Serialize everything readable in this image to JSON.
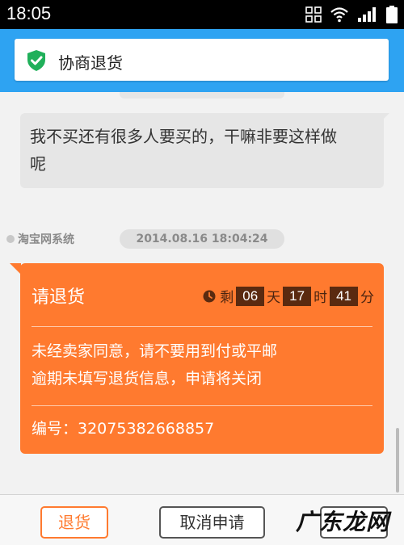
{
  "status_bar": {
    "time": "18:05",
    "icons": [
      "grid-icon",
      "wifi-icon",
      "signal-icon",
      "battery-icon"
    ]
  },
  "header": {
    "title": "协商退货",
    "icon": "shield-check-icon",
    "accent_color": "#2ea3f2"
  },
  "messages": [
    {
      "text_line1": "我不买还有很多人要买的，干嘛非要这样做",
      "text_line2": "呢"
    }
  ],
  "system": {
    "sender": "淘宝网系统",
    "timestamp": "2014.08.16 18:04:24"
  },
  "order_card": {
    "title": "请退货",
    "countdown": {
      "prefix": "剩",
      "days": "06",
      "day_unit": "天",
      "hours": "17",
      "hour_unit": "时",
      "minutes": "41",
      "minute_unit": "分"
    },
    "notice_line1": "未经卖家同意，请不要用到付或平邮",
    "notice_line2": "逾期未填写退货信息，申请将关闭",
    "order_no": "编号：32075382668857",
    "color": "#ff7a2f"
  },
  "bottom_bar": {
    "return_label": "退货",
    "cancel_label": "取消申请",
    "watermark": "广东龙网"
  }
}
